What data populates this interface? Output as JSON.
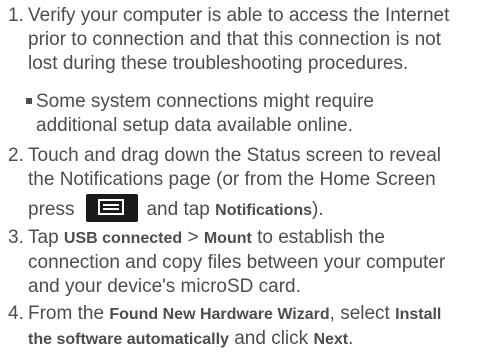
{
  "steps": [
    {
      "number": "1.",
      "lines": [
        "Verify your computer is able to access the Internet",
        "prior to connection and that this connection is not",
        "lost during these troubleshooting procedures."
      ],
      "bullet_lines": [
        "Some system connections might require",
        "additional setup data available online."
      ]
    },
    {
      "number": "2.",
      "line1": "Touch and drag down the Status screen to reveal",
      "line2": "the Notifications page (or from the Home Screen",
      "line3_pre": "press",
      "line3_mid": "and tap",
      "line3_bold": "Notifications",
      "line3_post": ")."
    },
    {
      "number": "3.",
      "line1_pre": "Tap",
      "line1_bold_a": "USB connected",
      "line1_sep": ">",
      "line1_bold_b": "Mount",
      "line1_post": "to establish the",
      "line2": "connection and copy files between your computer",
      "line3": "and your device's microSD card."
    },
    {
      "number": "4.",
      "line1_pre": "From the",
      "line1_bold_a": "Found New Hardware Wizard",
      "line1_mid": ", select",
      "line1_bold_b": "Install",
      "line2_bold": "the software automatically",
      "line2_mid": "and click",
      "line2_bold_b": "Next",
      "line2_post": "."
    }
  ],
  "icons": {
    "menu_key": "menu-key-icon"
  },
  "colors": {
    "text": "#4d4d4f",
    "key_bg": "#1b1b1b"
  }
}
